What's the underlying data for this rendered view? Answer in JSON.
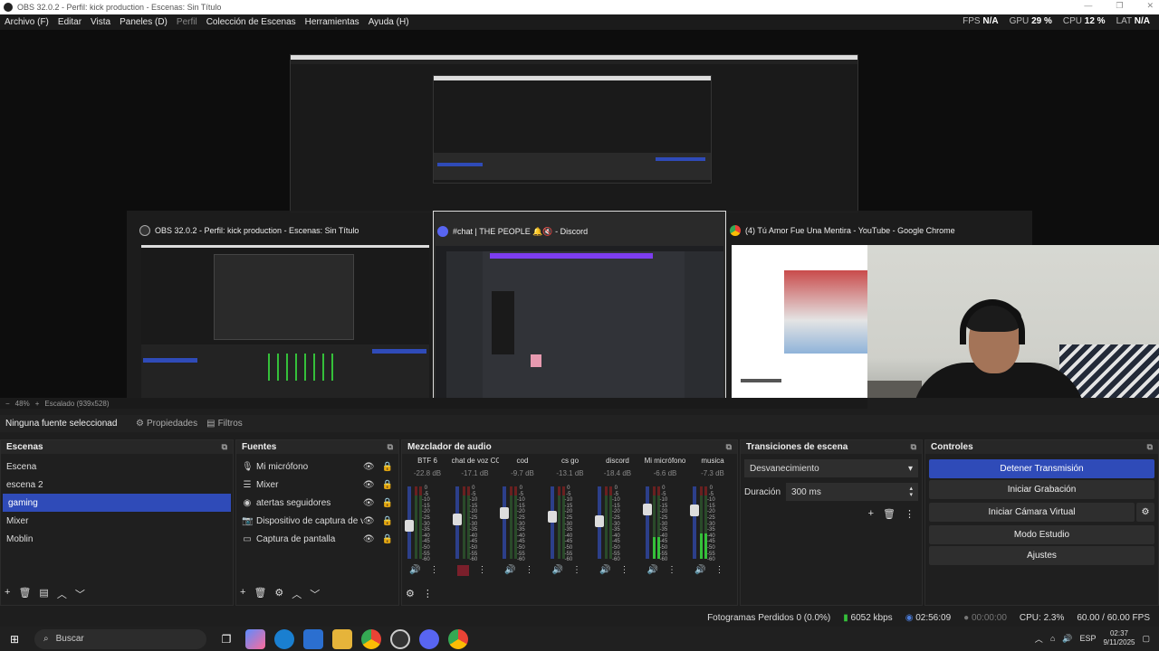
{
  "window": {
    "title": "OBS 32.0.2 - Perfil: kick production - Escenas: Sin Título"
  },
  "menu": {
    "items": [
      "Archivo (F)",
      "Editar",
      "Vista",
      "Paneles (D)",
      "Perfil",
      "Colección de Escenas",
      "Herramientas",
      "Ayuda (H)"
    ]
  },
  "stats": {
    "fps_label": "FPS",
    "fps": "N/A",
    "gpu_label": "GPU",
    "gpu": "29 %",
    "cpu_label": "CPU",
    "cpu": "12 %",
    "lat_label": "LAT",
    "lat": "N/A"
  },
  "alttab": {
    "win1": {
      "title": "OBS 32.0.2 - Perfil: kick production - Escenas: Sin Título",
      "icon": "obs-icon"
    },
    "win2": {
      "title": "#chat | THE PEOPLE 🔔🔇 - Discord",
      "icon": "discord-icon"
    },
    "win3": {
      "title": "(4) Tú Amor Fue Una Mentira - YouTube - Google Chrome",
      "icon": "chrome-icon"
    }
  },
  "preview": {
    "zoom": "48%",
    "scale": "Escalado (939x528)"
  },
  "source_toolbar": {
    "selection": "Ninguna fuente seleccionad",
    "properties": "Propiedades",
    "filters": "Filtros"
  },
  "scenes": {
    "title": "Escenas",
    "items": [
      "Escena",
      "escena 2",
      "gaming",
      "Mixer",
      "Moblin"
    ],
    "selected": "gaming"
  },
  "sources": {
    "title": "Fuentes",
    "items": [
      {
        "label": "Mi micrófono",
        "icon": "microphone-icon"
      },
      {
        "label": "Mixer",
        "icon": "list-icon"
      },
      {
        "label": "atertas seguidores",
        "icon": "browser-icon"
      },
      {
        "label": "Dispositivo de captura de vide",
        "icon": "camera-icon"
      },
      {
        "label": "Captura de pantalla",
        "icon": "monitor-icon"
      }
    ]
  },
  "mixer": {
    "title": "Mezclador de audio",
    "ticks": [
      "0",
      "-5",
      "-10",
      "-15",
      "-20",
      "-25",
      "-30",
      "-35",
      "-40",
      "-45",
      "-50",
      "-55",
      "-60"
    ],
    "channels": [
      {
        "name": "BTF 6",
        "db": "-22.8 dB",
        "level": 0.0,
        "fader": 0.45
      },
      {
        "name": "chat de voz COD",
        "db": "-17.1 dB",
        "level": 0.0,
        "fader": 0.55
      },
      {
        "name": "cod",
        "db": "-9.7 dB",
        "level": 0.0,
        "fader": 0.65
      },
      {
        "name": "cs go",
        "db": "-13.1 dB",
        "level": 0.0,
        "fader": 0.6
      },
      {
        "name": "discord",
        "db": "-18.4 dB",
        "level": 0.0,
        "fader": 0.52
      },
      {
        "name": "Mi micrófono",
        "db": "-6.6 dB",
        "level": 0.3,
        "fader": 0.72
      },
      {
        "name": "musica",
        "db": "-7.3 dB",
        "level": 0.35,
        "fader": 0.7
      }
    ]
  },
  "transitions": {
    "title": "Transiciones de escena",
    "type": "Desvanecimiento",
    "duration_label": "Duración",
    "duration": "300 ms"
  },
  "controls": {
    "title": "Controles",
    "stream": "Detener Transmisión",
    "record": "Iniciar Grabación",
    "vcam": "Iniciar Cámara Virtual",
    "studio": "Modo Estudio",
    "settings": "Ajustes"
  },
  "status": {
    "dropped": "Fotogramas Perdidos 0 (0.0%)",
    "bitrate": "6052 kbps",
    "stream_time": "02:56:09",
    "rec_time": "00:00:00",
    "cpu": "CPU: 2.3%",
    "fps": "60.00 / 60.00 FPS"
  },
  "taskbar": {
    "search": "Buscar",
    "lang": "ESP",
    "time": "02:37",
    "date": "9/11/2025"
  },
  "colors": {
    "accent": "#2f4bb8",
    "meter_green": "#35c03a",
    "meter_red": "#6a2020"
  }
}
